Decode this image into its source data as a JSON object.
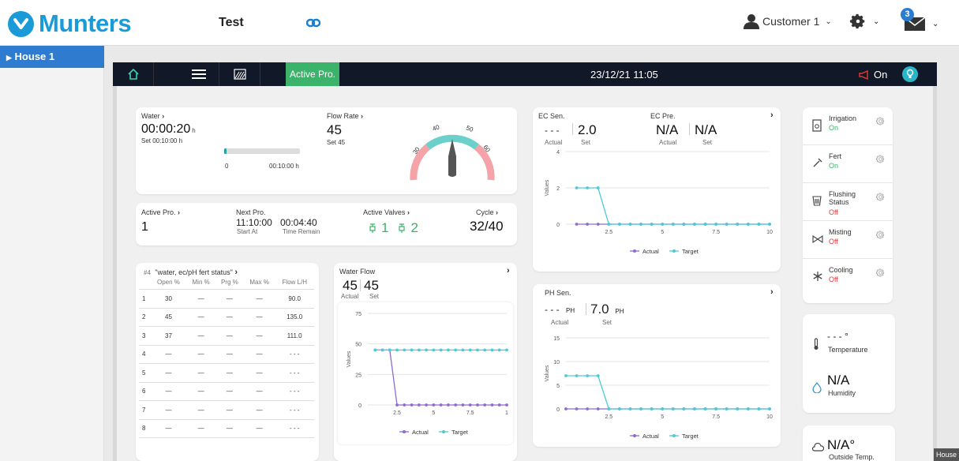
{
  "header": {
    "brand": "Munters",
    "site_title": "Test",
    "user_name": "Customer 1",
    "mail_count": "3"
  },
  "sidebar": {
    "house": "House 1"
  },
  "nav": {
    "active_label": "Active Pro.",
    "datetime": "23/12/21  11:05",
    "alarm_label": "On"
  },
  "water": {
    "title": "Water",
    "value": "00:00:20",
    "unit": "h",
    "set": "Set 00:10:00  h",
    "progress": 0.033,
    "bar_start": "0",
    "bar_end": "00:10:00  h"
  },
  "flow_rate": {
    "title": "Flow Rate",
    "value": "45",
    "set": "Set 45",
    "gauge_ticks": [
      "30",
      "40",
      "50",
      "60"
    ]
  },
  "status": {
    "active_pro_title": "Active Pro.",
    "active_pro_value": "1",
    "next_pro_title": "Next Pro.",
    "start_at_value": "11:10:00",
    "start_at_label": "Start At",
    "time_remain_value": "00:04:40",
    "time_remain_label": "Time Remain",
    "active_valves_title": "Active Valves",
    "valve_a": "1",
    "valve_b": "2",
    "cycle_title": "Cycle",
    "cycle_value": "32/40"
  },
  "valve_table": {
    "tag": "#4",
    "title": "\"water, ec/pH fert status\"",
    "headers": [
      "",
      "Open %",
      "Min %",
      "Prg %",
      "Max %",
      "Flow L/H"
    ],
    "rows": [
      [
        "1",
        "30",
        "—",
        "—",
        "—",
        "90.0"
      ],
      [
        "2",
        "45",
        "—",
        "—",
        "—",
        "135.0"
      ],
      [
        "3",
        "37",
        "—",
        "—",
        "—",
        "111.0"
      ],
      [
        "4",
        "—",
        "—",
        "—",
        "—",
        "- - -"
      ],
      [
        "5",
        "—",
        "—",
        "—",
        "—",
        "- - -"
      ],
      [
        "6",
        "—",
        "—",
        "—",
        "—",
        "- - -"
      ],
      [
        "7",
        "—",
        "—",
        "—",
        "—",
        "- - -"
      ],
      [
        "8",
        "—",
        "—",
        "—",
        "—",
        "- - -"
      ]
    ]
  },
  "water_flow": {
    "title": "Water Flow",
    "actual": "45",
    "set": "45",
    "actual_label": "Actual",
    "set_label": "Set"
  },
  "ec": {
    "sen_title": "EC Sen.",
    "sen_actual": "- - -",
    "sen_set": "2.0",
    "pre_title": "EC Pre.",
    "pre_actual": "N/A",
    "pre_set": "N/A",
    "actual_label": "Actual",
    "set_label": "Set"
  },
  "ph": {
    "title": "PH Sen.",
    "actual": "- - -",
    "actual_unit": "PH",
    "set": "7.0",
    "set_unit": "PH",
    "actual_label": "Actual",
    "set_label": "Set"
  },
  "legend": {
    "actual": "Actual",
    "target": "Target"
  },
  "devices": [
    {
      "name": "Irrigation",
      "status": "On",
      "color": "#3bb36a"
    },
    {
      "name": "Fert",
      "status": "On",
      "color": "#3bb36a"
    },
    {
      "name": "Flushing Status",
      "status": "Off",
      "color": "#e53935"
    },
    {
      "name": "Misting",
      "status": "Off",
      "color": "#e53935"
    },
    {
      "name": "Cooling",
      "status": "Off",
      "color": "#e53935"
    }
  ],
  "climate": {
    "temp_value": "- - - °",
    "temp_label": "Temperature",
    "hum_value": "N/A",
    "hum_label": "Humidity",
    "out_value": "N/A°",
    "out_label": "Outside Temp."
  },
  "footer_tag": "House",
  "colors": {
    "actual": "#8e6bd1",
    "target": "#4fc9d3",
    "accent": "#2e7bcf",
    "on": "#3bb36a",
    "off": "#e53935"
  },
  "chart_data": [
    {
      "type": "line",
      "title": "",
      "ylabel": "Values",
      "x": [
        1,
        1.5,
        2,
        2.5,
        3,
        3.5,
        4,
        4.5,
        5,
        5.5,
        6,
        6.5,
        7,
        7.5,
        8,
        8.5,
        9,
        9.5,
        10
      ],
      "xticks": [
        "2.5",
        "5",
        "7.5",
        "10"
      ],
      "yticks": [
        "0",
        "2",
        "4"
      ],
      "xlim": [
        0.5,
        10
      ],
      "ylim": [
        0,
        4
      ],
      "series": [
        {
          "name": "Actual",
          "values": [
            0,
            0,
            0,
            0,
            0,
            0,
            0,
            0,
            0,
            0,
            0,
            0,
            0,
            0,
            0,
            0,
            0,
            0,
            0
          ]
        },
        {
          "name": "Target",
          "values": [
            2,
            2,
            2,
            0,
            0,
            0,
            0,
            0,
            0,
            0,
            0,
            0,
            0,
            0,
            0,
            0,
            0,
            0,
            0
          ]
        }
      ]
    },
    {
      "type": "line",
      "title": "",
      "ylabel": "Values",
      "x": [
        0.5,
        1,
        1.5,
        2,
        2.5,
        3,
        3.5,
        4,
        4.5,
        5,
        5.5,
        6,
        6.5,
        7,
        7.5,
        8,
        8.5,
        9,
        9.5,
        10
      ],
      "xticks": [
        "2.5",
        "5",
        "7.5",
        "10"
      ],
      "yticks": [
        "0",
        "5",
        "10",
        "15"
      ],
      "xlim": [
        0.5,
        10
      ],
      "ylim": [
        0,
        15
      ],
      "series": [
        {
          "name": "Actual",
          "values": [
            0,
            0,
            0,
            0,
            0,
            0,
            0,
            0,
            0,
            0,
            0,
            0,
            0,
            0,
            0,
            0,
            0,
            0,
            0,
            0
          ]
        },
        {
          "name": "Target",
          "values": [
            7,
            7,
            7,
            7,
            0,
            0,
            0,
            0,
            0,
            0,
            0,
            0,
            0,
            0,
            0,
            0,
            0,
            0,
            0,
            0
          ]
        }
      ]
    },
    {
      "type": "line",
      "title": "",
      "ylabel": "Values",
      "x": [
        1,
        1.5,
        2,
        2.5,
        3,
        3.5,
        4,
        4.5,
        5,
        5.5,
        6,
        6.5,
        7,
        7.5,
        8,
        8.5,
        9,
        9.5,
        10
      ],
      "xticks": [
        "2.5",
        "5",
        "7.5",
        "1"
      ],
      "yticks": [
        "0",
        "25",
        "50",
        "75"
      ],
      "xlim": [
        0.5,
        10
      ],
      "ylim": [
        0,
        75
      ],
      "series": [
        {
          "name": "Actual",
          "values": [
            45,
            45,
            45,
            0,
            0,
            0,
            0,
            0,
            0,
            0,
            0,
            0,
            0,
            0,
            0,
            0,
            0,
            0,
            0
          ]
        },
        {
          "name": "Target",
          "values": [
            45,
            45,
            45,
            45,
            45,
            45,
            45,
            45,
            45,
            45,
            45,
            45,
            45,
            45,
            45,
            45,
            45,
            45,
            45
          ]
        }
      ]
    }
  ]
}
